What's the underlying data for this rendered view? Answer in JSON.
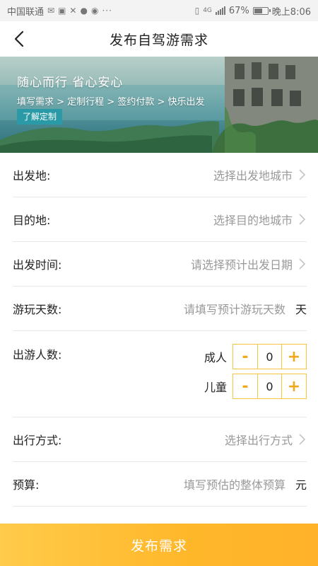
{
  "status_bar": {
    "carrier": "中国联通",
    "network": "4G",
    "battery": "67%",
    "battery_level": 0.67,
    "time": "晚上8:06",
    "more": "···"
  },
  "nav": {
    "title": "发布自驾游需求",
    "back_icon": "chevron-left-icon"
  },
  "banner": {
    "slogan": "随心而行  省心安心",
    "steps": "填写需求 > 定制行程 > 签约付款 > 快乐出发",
    "button_label": "了解定制"
  },
  "form": {
    "departure": {
      "label": "出发地:",
      "placeholder": "选择出发地城市"
    },
    "destination": {
      "label": "目的地:",
      "placeholder": "选择目的地城市"
    },
    "departure_time": {
      "label": "出发时间:",
      "placeholder": "请选择预计出发日期"
    },
    "days": {
      "label": "游玩天数:",
      "placeholder": "请填写预计游玩天数",
      "unit": "天"
    },
    "people": {
      "label": "出游人数:",
      "adult": {
        "label": "成人",
        "value": "0",
        "minus": "-",
        "plus": "+"
      },
      "child": {
        "label": "儿童",
        "value": "0",
        "minus": "-",
        "plus": "+"
      }
    },
    "travel_mode": {
      "label": "出行方式:",
      "placeholder": "选择出行方式"
    },
    "budget": {
      "label": "预算:",
      "placeholder": "填写预估的整体预算",
      "unit": "元"
    }
  },
  "submit": {
    "label": "发布需求"
  },
  "colors": {
    "accent": "#f5b531",
    "stepper_border": "#f5c542",
    "banner_button": "#2a9aa6",
    "placeholder": "#999999",
    "divider": "#e8e8e8"
  }
}
